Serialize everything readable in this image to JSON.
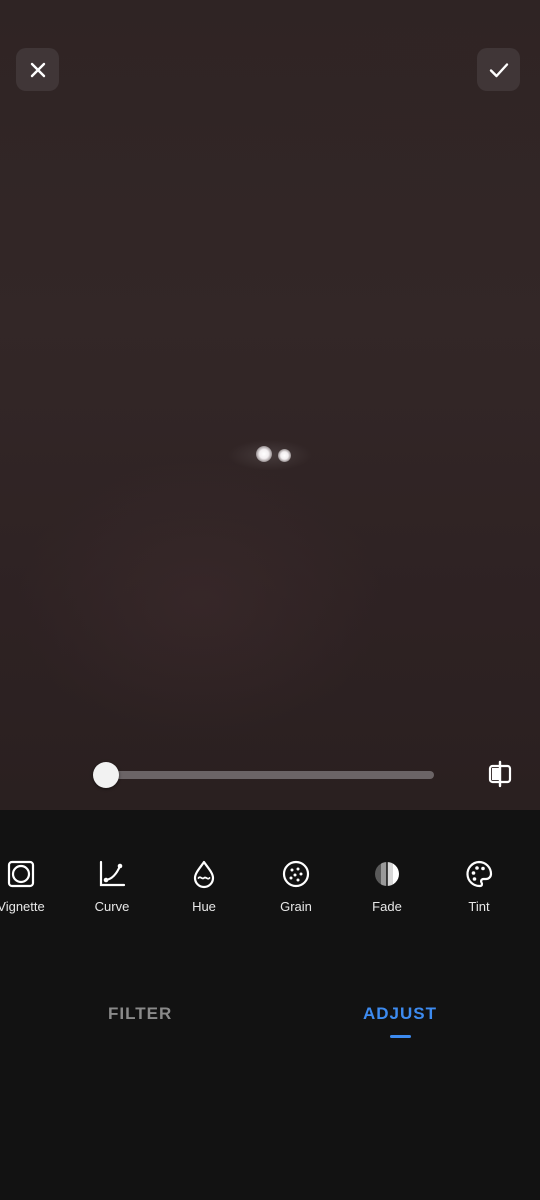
{
  "toolbar": {
    "close_icon": "close-icon",
    "confirm_icon": "check-icon"
  },
  "adjust_slider": {
    "value_fraction": 0.0,
    "compare_icon": "split-compare-icon"
  },
  "tools": [
    {
      "label": "Vignette",
      "icon": "vignette-icon"
    },
    {
      "label": "Curve",
      "icon": "curve-icon"
    },
    {
      "label": "Hue",
      "icon": "droplet-icon"
    },
    {
      "label": "Grain",
      "icon": "grain-icon"
    },
    {
      "label": "Fade",
      "icon": "fade-icon"
    },
    {
      "label": "Tint",
      "icon": "palette-icon"
    }
  ],
  "tabs": [
    {
      "label": "FILTER",
      "active": false
    },
    {
      "label": "ADJUST",
      "active": true
    }
  ],
  "colors": {
    "accent": "#3d8bf0",
    "panel_bg": "#121212",
    "inactive_tab": "#8a8a8a"
  }
}
